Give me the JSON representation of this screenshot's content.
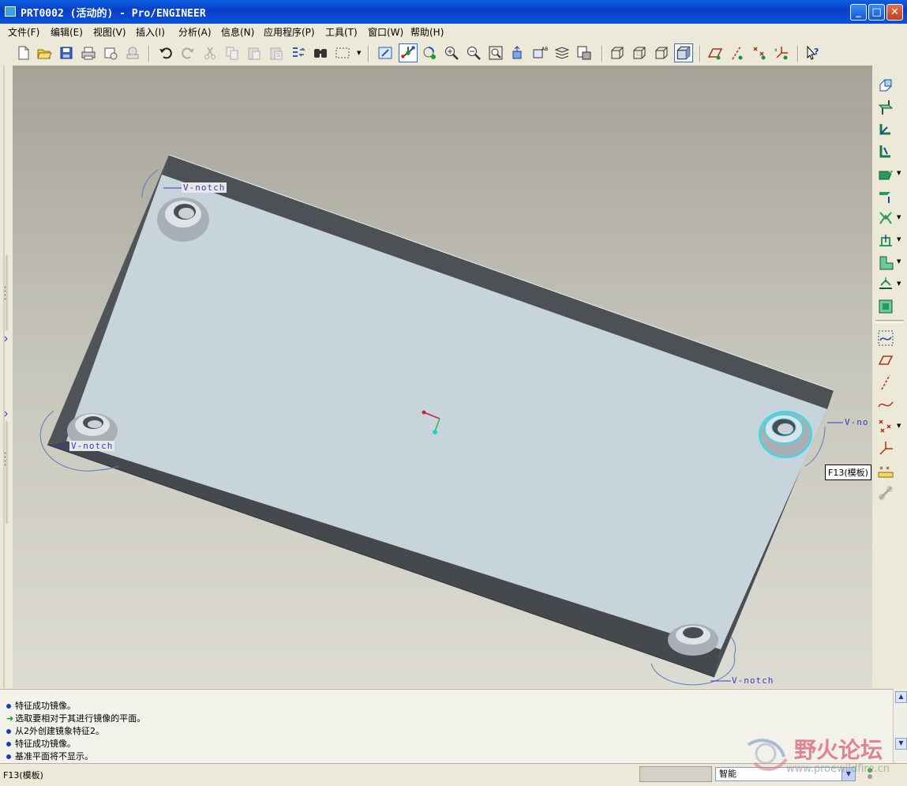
{
  "window": {
    "title": "PRT0002 (活动的) - Pro/ENGINEER",
    "buttons": {
      "minimize": "_",
      "maximize": "□",
      "close": "✕"
    }
  },
  "menu": [
    {
      "label": "文件(F)"
    },
    {
      "label": "编辑(E)"
    },
    {
      "label": "视图(V)"
    },
    {
      "label": "插入(I)"
    },
    {
      "label": "分析(A)"
    },
    {
      "label": "信息(N)"
    },
    {
      "label": "应用程序(P)"
    },
    {
      "label": "工具(T)"
    },
    {
      "label": "窗口(W)"
    },
    {
      "label": "帮助(H)"
    }
  ],
  "toolbar_icons": [
    "new-file-icon",
    "open-file-icon",
    "save-icon",
    "print-icon",
    "email-icon",
    "send-icon",
    "undo-icon",
    "redo-icon",
    "cut-icon",
    "copy-icon",
    "paste-icon",
    "paste-special-icon",
    "regenerate-icon",
    "find-icon",
    "select-box-icon",
    "repaint-icon",
    "spin-center-icon",
    "orient-mode-icon",
    "zoom-in-icon",
    "zoom-out-icon",
    "refit-icon",
    "reorient-icon",
    "saved-views-icon",
    "layers-icon",
    "view-manager-icon",
    "wireframe-icon",
    "hidden-line-icon",
    "no-hidden-icon",
    "shading-icon",
    "datum-planes-icon",
    "datum-axes-icon",
    "datum-points-icon",
    "coord-sys-icon",
    "context-help-icon"
  ],
  "right_toolbar_icons": [
    "hole-tool-icon",
    "shell-tool-icon",
    "rib-tool-icon",
    "draft-tool-icon",
    "round-tool-icon",
    "chamfer-tool-icon",
    "mirror-tool-icon",
    "extrude-tool-icon",
    "revolve-tool-icon",
    "sweep-tool-icon",
    "pattern-tool-icon",
    "sketch-tool-icon",
    "datum-plane-tool-icon",
    "datum-axis-tool-icon",
    "datum-curve-tool-icon",
    "datum-point-tool-icon",
    "coord-sys-tool-icon",
    "analysis-feature-icon",
    "merge-tool-icon"
  ],
  "model": {
    "annotations": [
      "V-notch",
      "V-notch",
      "V-no",
      "V-notch"
    ],
    "tooltip": "F13(模板)"
  },
  "messages": [
    {
      "type": "info",
      "text": "特征成功镜像。"
    },
    {
      "type": "prompt",
      "text": "选取要相对于其进行镜像的平面。"
    },
    {
      "type": "info",
      "text": "从2外创建镜象特征2。"
    },
    {
      "type": "info",
      "text": "特征成功镜像。"
    },
    {
      "type": "info",
      "text": "基准平面将不显示。"
    }
  ],
  "status": {
    "text": "F13(模板)",
    "filter": "智能"
  },
  "watermark": {
    "name": "野火论坛",
    "url": "www.proewildfire.cn"
  }
}
